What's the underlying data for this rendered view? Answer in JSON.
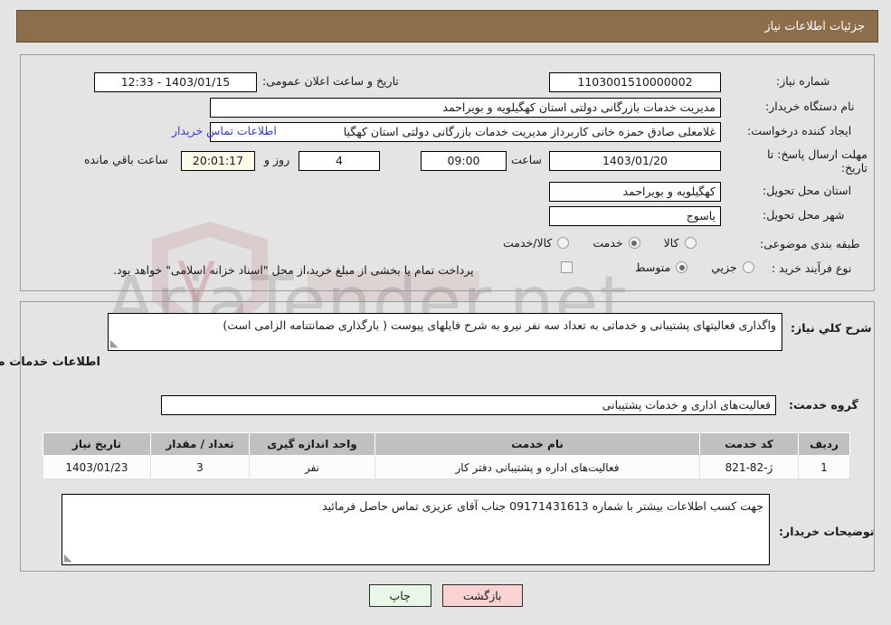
{
  "header": {
    "title": "جزئیات اطلاعات نیاز"
  },
  "colors": {
    "header_bg": "#8d6e4b",
    "header_text": "#ffffff",
    "page_bg": "#e4e4e4",
    "link": "#2d3fd4",
    "table_header_bg": "#c0c0c0",
    "print_button_bg": "#e9f7e9",
    "back_button_bg": "#fbd2d2",
    "countdown_bg": "#fbfbe8"
  },
  "form": {
    "need_number_label": "شماره نیاز:",
    "need_number_value": "1103001510000002",
    "announce_datetime_label": "تاریخ و ساعت اعلان عمومی:",
    "announce_datetime_value": "1403/01/15 - 12:33",
    "buyer_org_label": "نام دستگاه خریدار:",
    "buyer_org_value": "مدیریت خدمات بازرگانی دولتی استان کهگیلویه و بویراحمد",
    "requester_label": "ایجاد کننده درخواست:",
    "requester_value": "غلامعلی صادق حمزه خانی کاربرداز مدیریت خدمات بازرگانی دولتی استان کهگیا",
    "buyer_contact_link": "اطلاعات تماس خریدار",
    "deadline_label": "مهلت ارسال پاسخ: تا تاریخ:",
    "deadline_date": "1403/01/20",
    "deadline_time_label": "ساعت",
    "deadline_time": "09:00",
    "days_remaining": "4",
    "days_label": "روز و",
    "countdown": "20:01:17",
    "countdown_label": "ساعت باقي مانده",
    "province_label": "استان محل تحویل:",
    "province_value": "کهگیلویه و بویراحمد",
    "city_label": "شهر محل تحویل:",
    "city_value": "یاسوج",
    "category_label": "طبقه بندی موضوعی:",
    "category_options": [
      {
        "label": "کالا",
        "selected": false
      },
      {
        "label": "خدمت",
        "selected": true
      },
      {
        "label": "کالا/خدمت",
        "selected": false
      }
    ],
    "process_label": "نوع فرآیند خرید :",
    "process_options": [
      {
        "label": "جزیي",
        "selected": false
      },
      {
        "label": "متوسط",
        "selected": true
      }
    ],
    "treasury_checkbox_checked": false,
    "treasury_note": "پرداخت تمام یا بخشی از مبلغ خرید،از محل \"اسناد خزانه اسلامی\" خواهد بود."
  },
  "description": {
    "label": "شرح کلي نیاز:",
    "value": "واگذاری فعالیتهای پشتیبانی و خدماتی به تعداد سه نفر نیرو به شرح فایلهای پیوست ( بارگذاری ضمانتنامه الزامی است)"
  },
  "services_section": {
    "title": "اطلاعات خدمات مورد نیاز",
    "group_label": "گروه خدمت:",
    "group_value": "فعالیت‌های اداری و خدمات پشتیبانی"
  },
  "table": {
    "columns": [
      "ردیف",
      "کد خدمت",
      "نام خدمت",
      "واحد اندازه گیری",
      "تعداد / مقدار",
      "تاریخ نیاز"
    ],
    "rows": [
      {
        "row": "1",
        "code": "ژ-82-821",
        "name": "فعالیت‌های اداره و پشتیبانی دفتر کار",
        "unit": "نفر",
        "quantity": "3",
        "need_date": "1403/01/23"
      }
    ]
  },
  "buyer_notes": {
    "label": "توضیحات خریدار:",
    "value": "جهت کسب اطلاعات بیشتر با شماره 09171431613 جناب آقای عزیزی تماس حاصل فرمائید"
  },
  "buttons": {
    "print": "چاپ",
    "back": "بازگشت"
  },
  "watermark": {
    "text": "AriaTender.net"
  }
}
